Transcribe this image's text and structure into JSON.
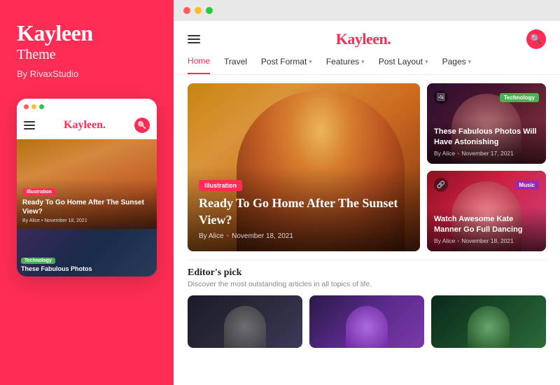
{
  "left_panel": {
    "brand": {
      "name": "Kayleen",
      "subtitle": "Theme",
      "by_label": "By RivaxStudio"
    },
    "mobile_preview": {
      "dots": [
        "red",
        "yellow",
        "green"
      ],
      "logo": "Kayleen",
      "logo_dot": ".",
      "hero_tag": "Illustration",
      "hero_title": "Ready To Go Home After The Sunset View?",
      "hero_meta": "By Alice  •  November 18, 2021",
      "second_tag": "Technology",
      "second_title": "These Fabulous Photos"
    }
  },
  "browser": {
    "dots": [
      "red",
      "yellow",
      "green"
    ],
    "site": {
      "logo": "Kayleen",
      "logo_dot": ".",
      "nav": [
        {
          "label": "Home",
          "active": true,
          "has_arrow": false
        },
        {
          "label": "Travel",
          "active": false,
          "has_arrow": false
        },
        {
          "label": "Post Format",
          "active": false,
          "has_arrow": true
        },
        {
          "label": "Features",
          "active": false,
          "has_arrow": true
        },
        {
          "label": "Post Layout",
          "active": false,
          "has_arrow": true
        },
        {
          "label": "Pages",
          "active": false,
          "has_arrow": true
        }
      ],
      "hero_article": {
        "tag": "Illustration",
        "title": "Ready To Go Home After The Sunset View?",
        "meta_author": "By Alice",
        "meta_date": "November 18, 2021"
      },
      "side_articles": [
        {
          "tag": "Technology",
          "tag_type": "technology",
          "title": "These Fabulous Photos Will Have Astonishing",
          "meta_author": "By Alice",
          "meta_date": "November 17, 2021",
          "icon": "🖼"
        },
        {
          "tag": "Music",
          "tag_type": "music",
          "title": "Watch Awesome Kate Manner Go Full Dancing",
          "meta_author": "By Alice",
          "meta_date": "November 18, 2021",
          "icon": "🔗"
        }
      ],
      "editors_pick": {
        "title": "Editor's pick",
        "subtitle": "Discover the most outstanding articles in all topics of life.",
        "cards": [
          {
            "bg": "card-1"
          },
          {
            "bg": "card-2"
          },
          {
            "bg": "card-3"
          }
        ]
      }
    }
  }
}
